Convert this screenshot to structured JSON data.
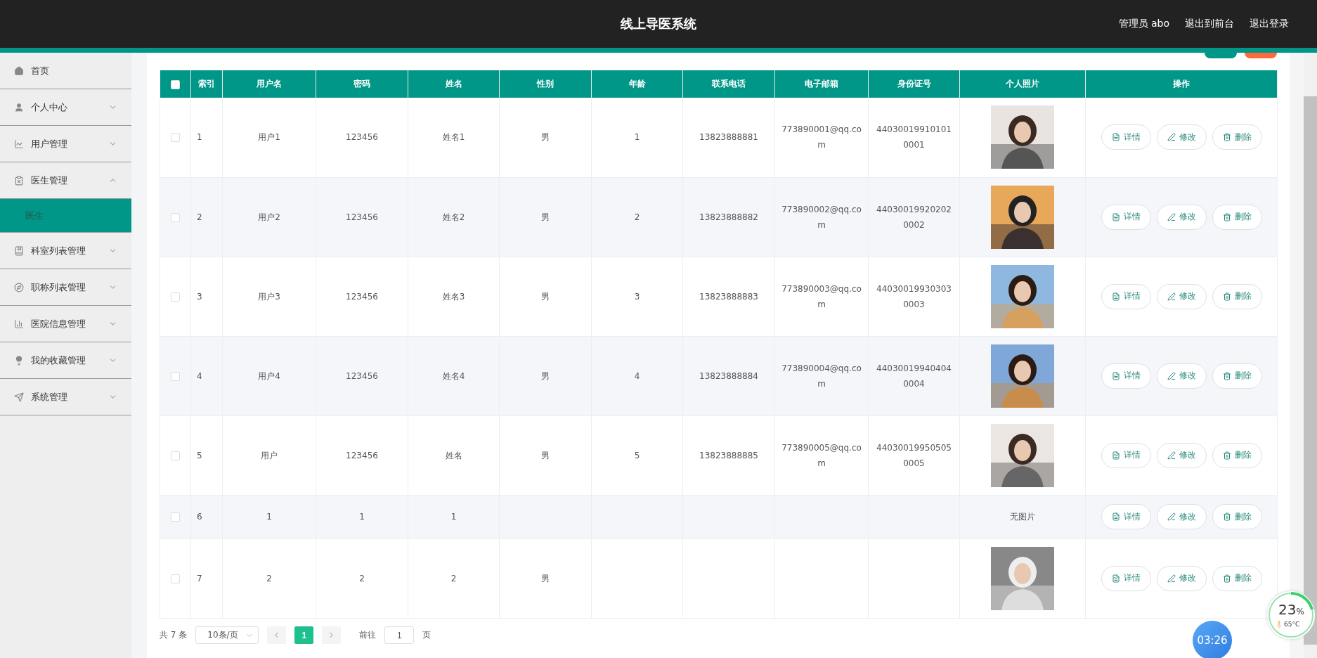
{
  "header": {
    "title": "线上导医系统",
    "links": [
      "管理员 abo",
      "退出到前台",
      "退出登录"
    ]
  },
  "sidebar": {
    "items": [
      {
        "label": "首页"
      },
      {
        "label": "个人中心",
        "expanded": false
      },
      {
        "label": "用户管理",
        "expanded": false
      },
      {
        "label": "医生管理",
        "expanded": true,
        "children": [
          {
            "label": "医生",
            "selected": true
          }
        ]
      },
      {
        "label": "科室列表管理",
        "expanded": false
      },
      {
        "label": "职称列表管理",
        "expanded": false
      },
      {
        "label": "医院信息管理",
        "expanded": false
      },
      {
        "label": "我的收藏管理",
        "expanded": false
      },
      {
        "label": "系统管理",
        "expanded": false
      }
    ]
  },
  "table": {
    "select_all": {
      "checked": false
    },
    "columns": [
      "索引",
      "用户名",
      "密码",
      "姓名",
      "性别",
      "年龄",
      "联系电话",
      "电子邮箱",
      "身份证号",
      "个人照片",
      "操作"
    ],
    "rows": [
      {
        "checked": false,
        "cells": [
          "1",
          "用户1",
          "123456",
          "姓名1",
          "男",
          "1",
          "13823888881",
          "773890001@qq.com",
          "440300199101010001"
        ],
        "actions": [
          "详情",
          "修改",
          "删除"
        ]
      },
      {
        "checked": false,
        "cells": [
          "2",
          "用户2",
          "123456",
          "姓名2",
          "男",
          "2",
          "13823888882",
          "773890002@qq.com",
          "440300199202020002"
        ],
        "actions": [
          "详情",
          "修改",
          "删除"
        ]
      },
      {
        "checked": false,
        "cells": [
          "3",
          "用户3",
          "123456",
          "姓名3",
          "男",
          "3",
          "13823888883",
          "773890003@qq.com",
          "440300199303030003"
        ],
        "actions": [
          "详情",
          "修改",
          "删除"
        ]
      },
      {
        "checked": false,
        "cells": [
          "4",
          "用户4",
          "123456",
          "姓名4",
          "男",
          "4",
          "13823888884",
          "773890004@qq.com",
          "440300199404040004"
        ],
        "actions": [
          "详情",
          "修改",
          "删除"
        ]
      },
      {
        "checked": false,
        "cells": [
          "5",
          "用户",
          "123456",
          "姓名",
          "男",
          "5",
          "13823888885",
          "773890005@qq.com",
          "440300199505050005"
        ],
        "actions": [
          "详情",
          "修改",
          "删除"
        ]
      },
      {
        "checked": false,
        "cells": [
          "6",
          "1",
          "1",
          "1",
          "",
          "",
          "",
          "",
          ""
        ],
        "photo": {
          "kind": "text",
          "text": "无图片"
        },
        "actions": [
          "详情",
          "修改",
          "删除"
        ]
      },
      {
        "checked": false,
        "cells": [
          "7",
          "2",
          "2",
          "2",
          "男",
          "",
          "",
          "",
          ""
        ],
        "actions": [
          "详情",
          "修改",
          "删除"
        ]
      }
    ]
  },
  "pagination": {
    "total": "共 7 条",
    "page_size": "10条/页",
    "pages": [
      {
        "label": "1",
        "selected": true
      }
    ],
    "goto_label": "前往",
    "goto_value": "1",
    "goto_suffix": "页"
  },
  "overlay": {
    "clock": "03:26",
    "gauge": {
      "percent": "23",
      "unit": "%",
      "temperature": "65°C"
    }
  }
}
